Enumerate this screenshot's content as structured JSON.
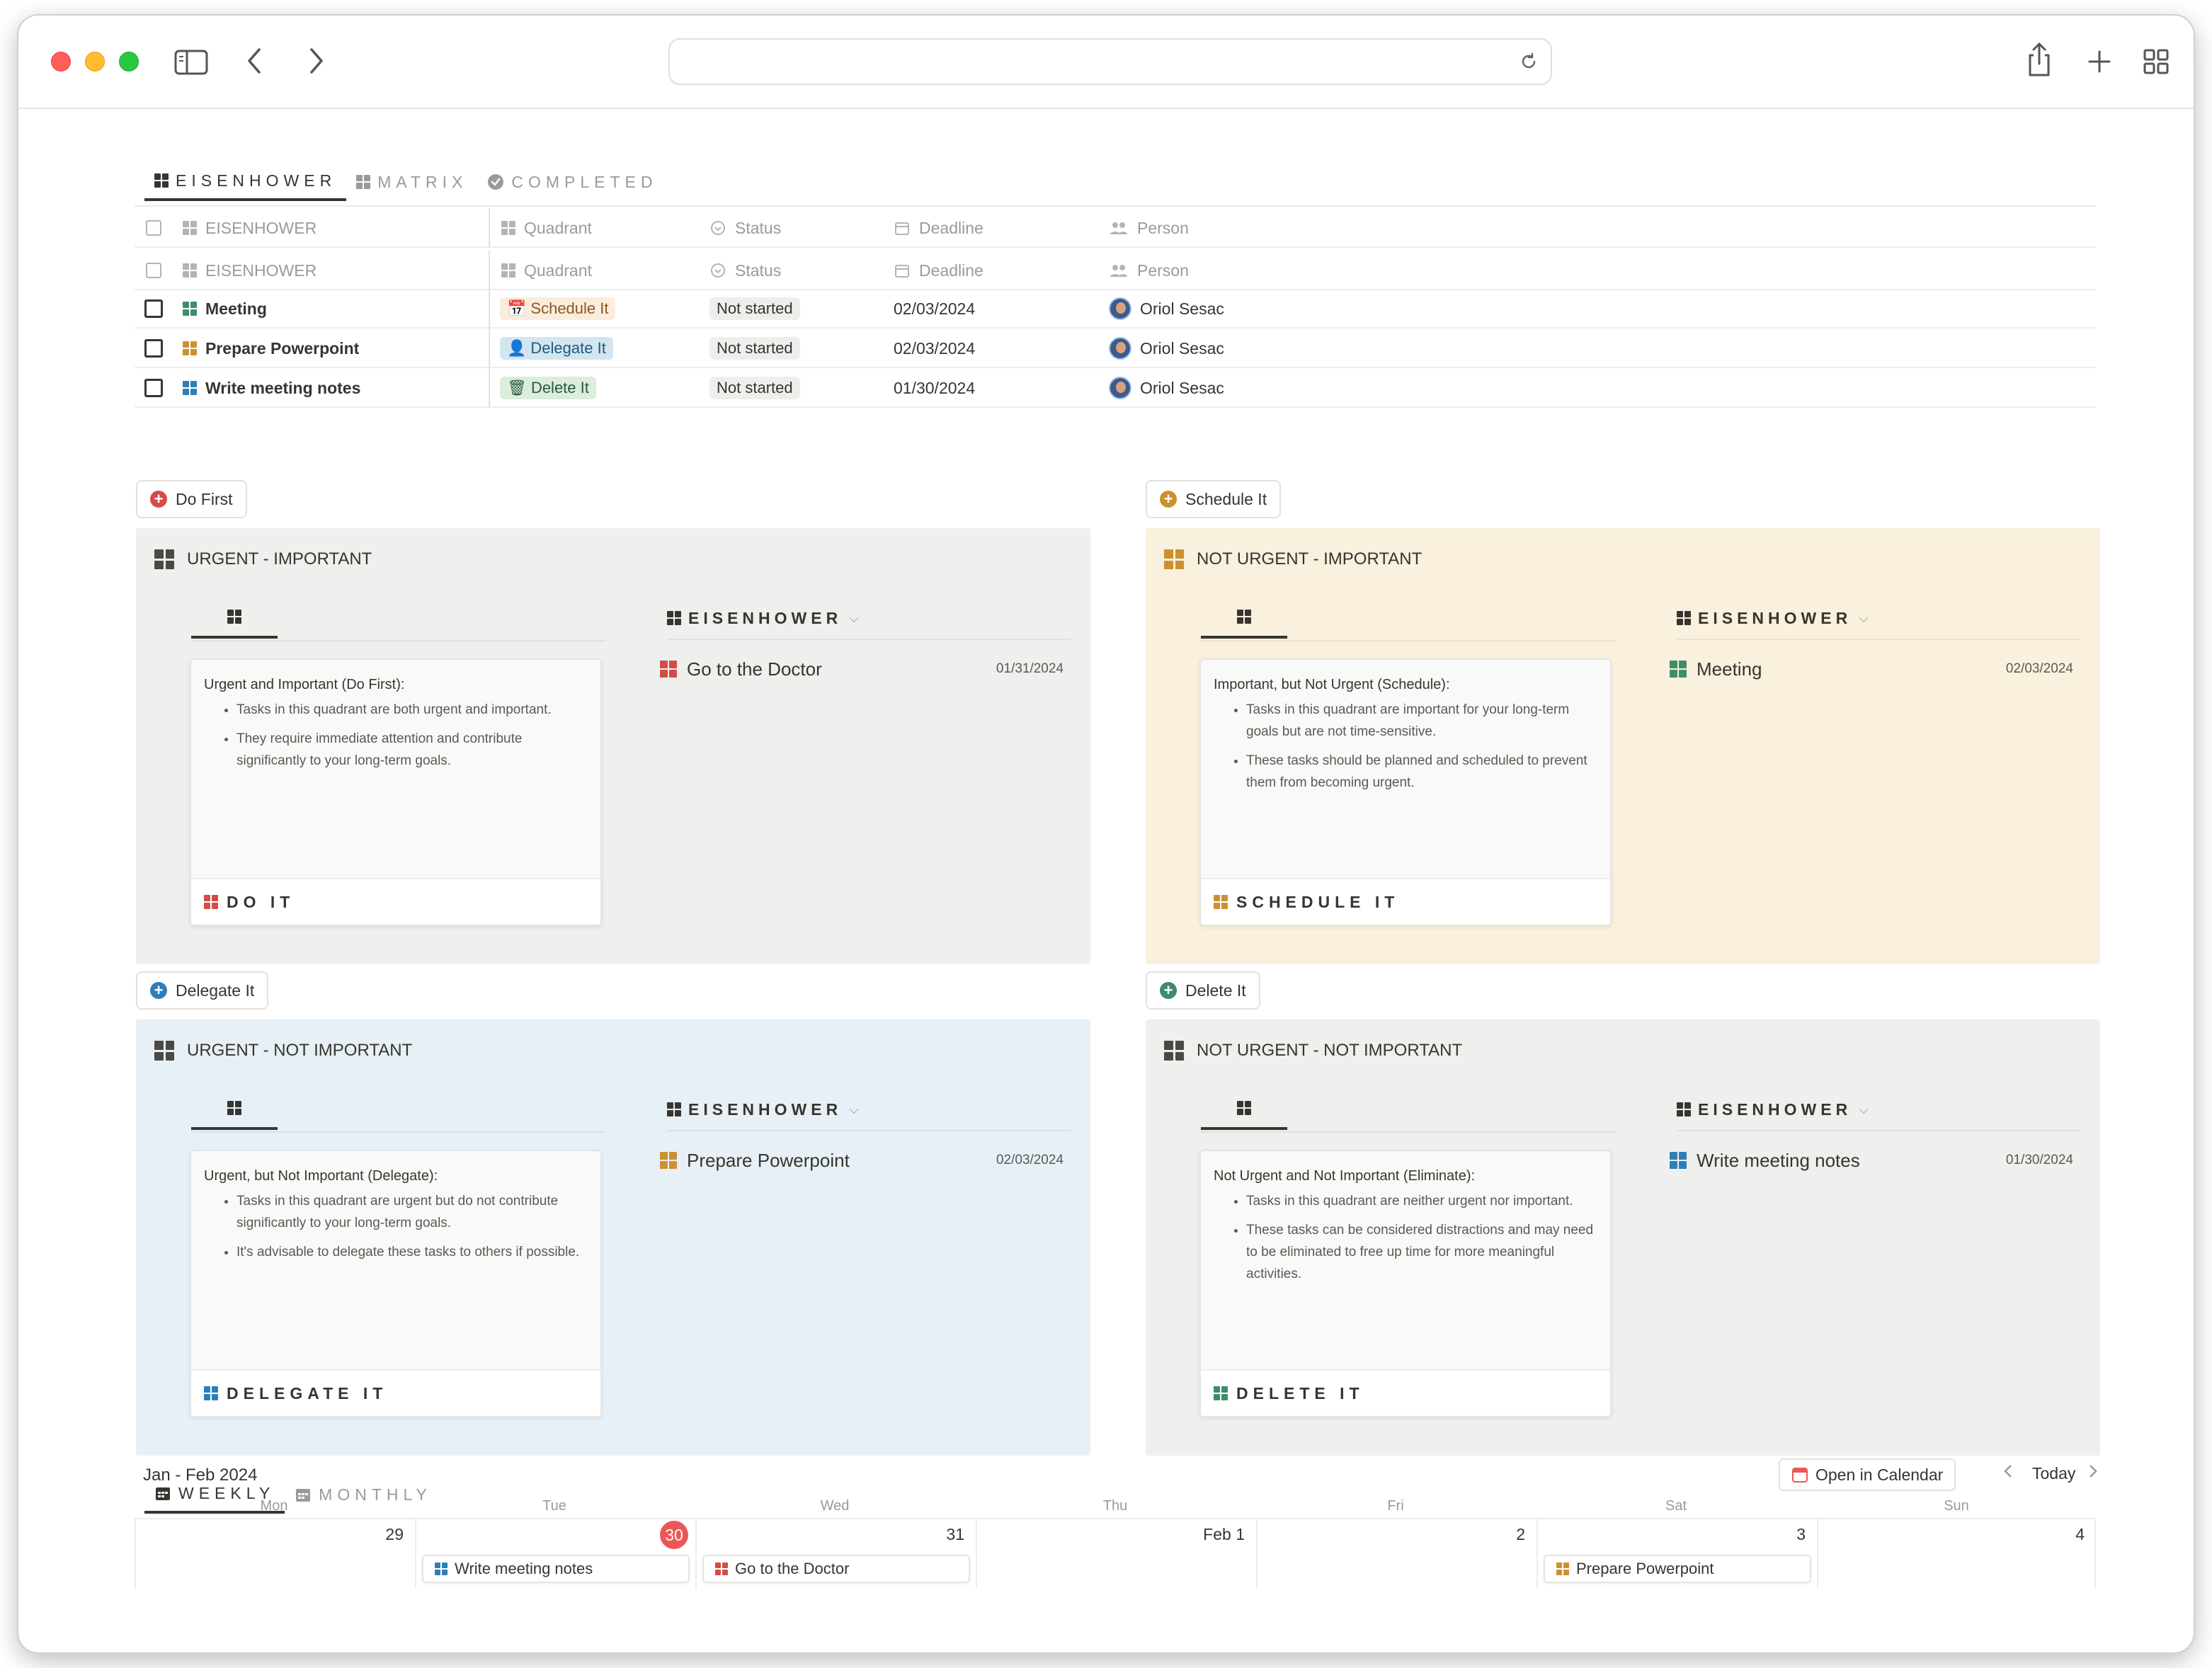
{
  "browser": {
    "icons": [
      "sidebar-icon",
      "back-arrow-icon",
      "forward-arrow-icon",
      "reload-icon",
      "share-icon",
      "new-tab-icon",
      "tab-overview-icon"
    ],
    "colors": {
      "close": "#fe5f57",
      "minimize": "#febc2e",
      "maximize": "#28c840"
    }
  },
  "views": {
    "tabs": [
      {
        "label": "EISENHOWER",
        "active": true
      },
      {
        "label": "MATRIX",
        "active": false
      },
      {
        "label": "COMPLETED",
        "active": false
      }
    ]
  },
  "table": {
    "headers": {
      "name": "EISENHOWER",
      "quadrant": "Quadrant",
      "status": "Status",
      "deadline": "Deadline",
      "person": "Person"
    },
    "rows": [
      {
        "name": "Meeting",
        "quadrant": "Schedule It",
        "status": "Not started",
        "deadline": "02/03/2024",
        "person": "Oriol Sesac"
      },
      {
        "name": "Prepare Powerpoint",
        "quadrant": "Delegate It",
        "status": "Not started",
        "deadline": "02/03/2024",
        "person": "Oriol Sesac"
      },
      {
        "name": "Write meeting notes",
        "quadrant": "Delete It",
        "status": "Not started",
        "deadline": "01/30/2024",
        "person": "Oriol Sesac"
      }
    ]
  },
  "quadrants": [
    {
      "button": "Do First",
      "title": "URGENT - IMPORTANT",
      "bg": "#edf0ec",
      "accent": "#d44c47",
      "card_heading": "Urgent and Important (Do First):",
      "bullets": [
        "Tasks in this quadrant are both urgent and important.",
        "They require immediate attention and contribute significantly to your long-term goals."
      ],
      "card_footer": "DO IT",
      "view_label": "EISENHOWER",
      "item": {
        "name": "Go to the Doctor",
        "date": "01/31/2024"
      }
    },
    {
      "button": "Schedule It",
      "title": "NOT URGENT - IMPORTANT",
      "bg": "#f9f0dd",
      "accent": "#cb912f",
      "card_heading": "Important, but Not Urgent (Schedule):",
      "bullets": [
        "Tasks in this quadrant are important for your long-term goals but are not time-sensitive.",
        "These tasks should be planned and scheduled to prevent them from becoming urgent."
      ],
      "card_footer": "SCHEDULE IT",
      "view_label": "EISENHOWER",
      "item": {
        "name": "Meeting",
        "date": "02/03/2024"
      }
    },
    {
      "button": "Delegate It",
      "title": "URGENT - NOT IMPORTANT",
      "bg": "#e7f0f6",
      "accent": "#2e7fb8",
      "card_heading": "Urgent, but Not Important (Delegate):",
      "bullets": [
        "Tasks in this quadrant are urgent but do not contribute significantly to your long-term goals.",
        "It's advisable to delegate these tasks to others if possible."
      ],
      "card_footer": "DELEGATE IT",
      "view_label": "EISENHOWER",
      "item": {
        "name": "Prepare Powerpoint",
        "date": "02/03/2024"
      }
    },
    {
      "button": "Delete It",
      "title": "NOT URGENT - NOT IMPORTANT",
      "bg": "#edf0ec",
      "accent": "#3f8c6a",
      "card_heading": "Not Urgent and Not Important (Eliminate):",
      "bullets": [
        "Tasks in this quadrant are neither urgent nor important.",
        "These tasks can be considered distractions and may need to be eliminated to free up time for more meaningful activities."
      ],
      "card_footer": "DELETE IT",
      "view_label": "EISENHOWER",
      "item": {
        "name": "Write meeting notes",
        "date": "01/30/2024"
      }
    }
  ],
  "calendar": {
    "tabs": [
      {
        "label": "WEEKLY",
        "active": true
      },
      {
        "label": "MONTHLY",
        "active": false
      }
    ],
    "range": "Jan - Feb 2024",
    "open_in_calendar": "Open in Calendar",
    "today": "Today",
    "weekdays": [
      "Mon",
      "Tue",
      "Wed",
      "Thu",
      "Fri",
      "Sat",
      "Sun"
    ],
    "days": [
      "29",
      "30",
      "31",
      "Feb 1",
      "2",
      "3",
      "4"
    ],
    "today_day": "30",
    "events": {
      "Tue": "Write meeting notes",
      "Wed": "Go to the Doctor",
      "Sat": "Prepare Powerpoint"
    }
  }
}
